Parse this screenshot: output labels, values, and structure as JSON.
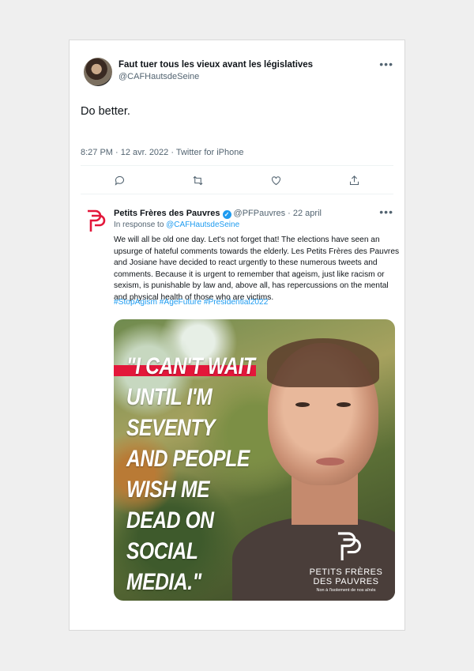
{
  "tweet": {
    "author_name": "Faut tuer tous les vieux avant les législatives",
    "handle": "@CAFHautsdeSeine",
    "text": "Do better.",
    "meta": "8:27 PM · 12 avr. 2022 · Twitter for iPhone"
  },
  "actions": [
    "reply-icon",
    "retweet-icon",
    "like-icon",
    "share-icon"
  ],
  "quoted": {
    "name": "Petits Frères des Pauvres",
    "handle_date": "@PFPauvres · 22 april",
    "in_response_prefix": "In response to ",
    "in_response_handle": "@CAFHautsdeSeine",
    "text": "We will all be old one day. Let's not forget that! The elections have seen an upsurge of hateful comments towards the elderly. Les Petits Frères des Pauvres and Josiane have decided to react urgently to these numerous tweets and comments. Because it is urgent to remember that ageism, just like racism or sexism, is punishable by law and, above all, has repercussions on the mental and physical health of those who are victims.",
    "hashtags": "#StopAgism #AgeFuture #Presidential2022"
  },
  "media": {
    "quote": "\"I CAN'T WAIT\nUNTIL I'M\nSEVENTY\nAND PEOPLE\nWISH ME\nDEAD ON\nSOCIAL MEDIA.\"",
    "brand": "PETITS FRÈRES DES PAUVRES",
    "tagline": "Non à l'isolement de nos aînés"
  },
  "colors": {
    "accent": "#1d9bf0",
    "brand_red": "#e3173a",
    "muted": "#536471"
  }
}
